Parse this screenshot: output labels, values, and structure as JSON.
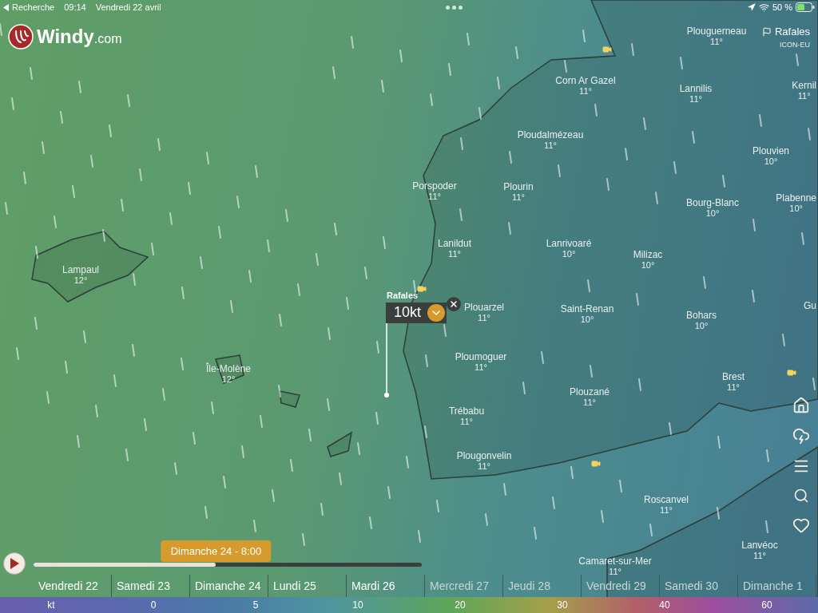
{
  "status_bar": {
    "back": "Recherche",
    "time": "09:14",
    "date": "Vendredi 22 avril",
    "battery": "50 %"
  },
  "logo": {
    "name": "Windy",
    "suffix": ".com"
  },
  "overlay": {
    "label": "Rafales",
    "model": "ICON-EU"
  },
  "places": [
    {
      "name": "Plouguerneau",
      "temp": "11°"
    },
    {
      "name": "Corn Ar Gazel",
      "temp": "11°"
    },
    {
      "name": "Lannilis",
      "temp": "11°"
    },
    {
      "name": "Kernil",
      "temp": "11°"
    },
    {
      "name": "Ploudalmézeau",
      "temp": "11°"
    },
    {
      "name": "Plouvien",
      "temp": "10°"
    },
    {
      "name": "Porspoder",
      "temp": "11°"
    },
    {
      "name": "Plourin",
      "temp": "11°"
    },
    {
      "name": "Bourg-Blanc",
      "temp": "10°"
    },
    {
      "name": "Plabenne",
      "temp": "10°"
    },
    {
      "name": "Lanildut",
      "temp": "11°"
    },
    {
      "name": "Lanrivoaré",
      "temp": "10°"
    },
    {
      "name": "Milizac",
      "temp": "10°"
    },
    {
      "name": "Lampaul",
      "temp": "12°"
    },
    {
      "name": "Plouarzel",
      "temp": "11°"
    },
    {
      "name": "Saint-Renan",
      "temp": "10°"
    },
    {
      "name": "Bohars",
      "temp": "10°"
    },
    {
      "name": "Gu"
    },
    {
      "name": "Ploumoguer",
      "temp": "11°"
    },
    {
      "name": "Île-Molène",
      "temp": "12°"
    },
    {
      "name": "Brest",
      "temp": "11°"
    },
    {
      "name": "Plouzané",
      "temp": "11°"
    },
    {
      "name": "Trébabu",
      "temp": "11°"
    },
    {
      "name": "Plougonvelin",
      "temp": "11°"
    },
    {
      "name": "Roscanvel",
      "temp": "11°"
    },
    {
      "name": "Lanvéoc",
      "temp": "11°"
    },
    {
      "name": "Camaret-sur-Mer",
      "temp": "11°"
    }
  ],
  "picker": {
    "label": "Rafales",
    "value": "10kt"
  },
  "timeline": {
    "tooltip": "Dimanche 24 - 8:00",
    "level": 0.47,
    "days": [
      {
        "label": "Vendredi 22",
        "disabled": false
      },
      {
        "label": "Samedi 23",
        "disabled": false
      },
      {
        "label": "Dimanche 24",
        "disabled": false
      },
      {
        "label": "Lundi 25",
        "disabled": false
      },
      {
        "label": "Mardi 26",
        "disabled": false
      },
      {
        "label": "Mercredi 27",
        "disabled": true
      },
      {
        "label": "Jeudi 28",
        "disabled": true
      },
      {
        "label": "Vendredi 29",
        "disabled": true
      },
      {
        "label": "Samedi 30",
        "disabled": true
      },
      {
        "label": "Dimanche 1",
        "disabled": true
      }
    ]
  },
  "legend": {
    "unit": "kt",
    "stops": [
      "0",
      "5",
      "10",
      "20",
      "30",
      "40",
      "60"
    ]
  }
}
